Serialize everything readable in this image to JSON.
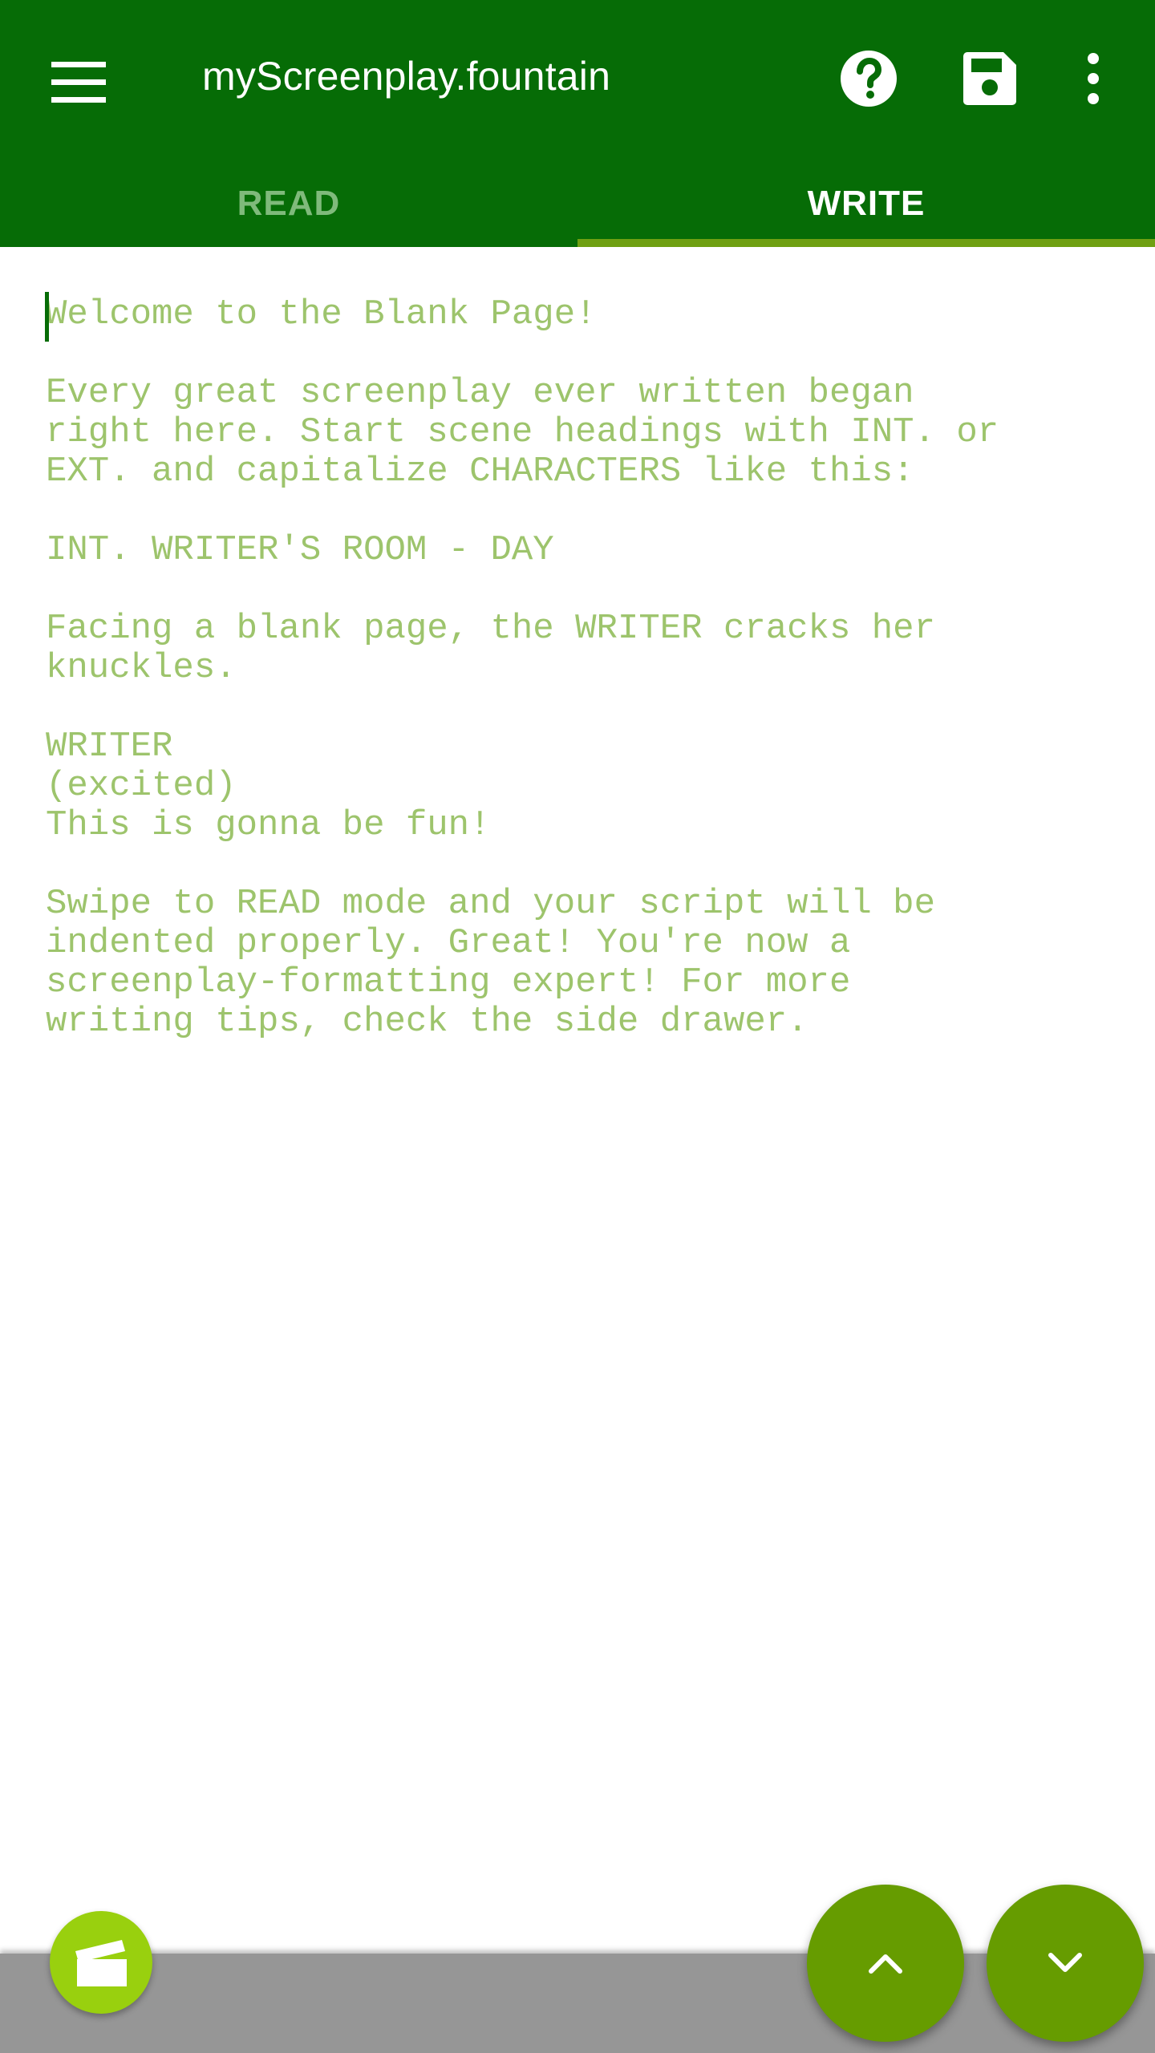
{
  "app_bar": {
    "title": "myScreenplay.fountain",
    "menu_icon": "hamburger-menu-icon",
    "actions": [
      {
        "name": "help",
        "icon": "help-circle-icon"
      },
      {
        "name": "save",
        "icon": "floppy-disk-icon"
      },
      {
        "name": "more",
        "icon": "more-vert-icon"
      }
    ]
  },
  "tabs": [
    {
      "label": "READ",
      "selected": false
    },
    {
      "label": "WRITE",
      "selected": true
    }
  ],
  "editor": {
    "text": "Welcome to the Blank Page!\n\nEvery great screenplay ever written began\nright here. Start scene headings with INT. or\nEXT. and capitalize CHARACTERS like this:\n\nINT. WRITER'S ROOM - DAY\n\nFacing a blank page, the WRITER cracks her\nknuckles.\n\nWRITER\n(excited)\nThis is gonna be fun!\n\nSwipe to READ mode and your script will be\nindented properly. Great! You're now a\nscreenplay-formatting expert! For more\nwriting tips, check the side drawer."
  },
  "fabs": [
    {
      "name": "clapperboard",
      "icon": "clapperboard-icon"
    },
    {
      "name": "scroll-up",
      "icon": "chevron-up-icon"
    },
    {
      "name": "scroll-down",
      "icon": "chevron-down-icon"
    }
  ],
  "colors": {
    "primary": "#066c06",
    "accent": "#6fa012",
    "editor_text": "#9dc46c",
    "fab": "#669c00",
    "fab_small": "#99d00e"
  }
}
